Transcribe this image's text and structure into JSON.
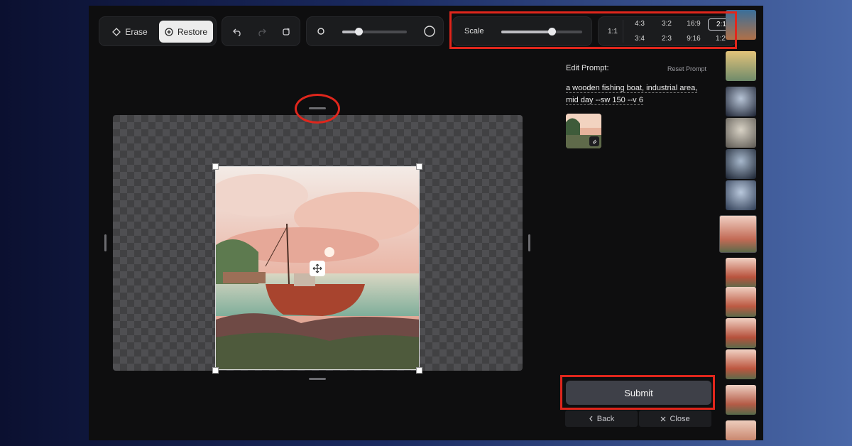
{
  "toolbar": {
    "erase_label": "Erase",
    "restore_label": "Restore",
    "brush_size": 0.25,
    "scale_label": "Scale",
    "scale_value": 0.62,
    "ratios_top": [
      "1:1",
      "4:3",
      "3:2",
      "16:9",
      "2:1"
    ],
    "ratios_bottom": [
      "3:4",
      "2:3",
      "9:16",
      "1:2"
    ],
    "selected_ratio": "2:1"
  },
  "panel": {
    "edit_prompt_label": "Edit Prompt:",
    "reset_prompt_label": "Reset Prompt",
    "prompt_line1": "a wooden fishing boat, industrial area,",
    "prompt_line2": "mid day --sw 150 --v 6",
    "submit_label": "Submit",
    "back_label": "Back",
    "close_label": "Close"
  },
  "colors": {
    "highlight": "#e0261c",
    "accent_selected": "#ececec"
  },
  "icons": [
    "eraser-icon",
    "restore-icon",
    "undo-icon",
    "redo-icon",
    "refresh-icon",
    "small-circle-icon",
    "large-circle-icon",
    "move-icon",
    "attachment-icon",
    "chevron-left-icon",
    "close-icon"
  ]
}
